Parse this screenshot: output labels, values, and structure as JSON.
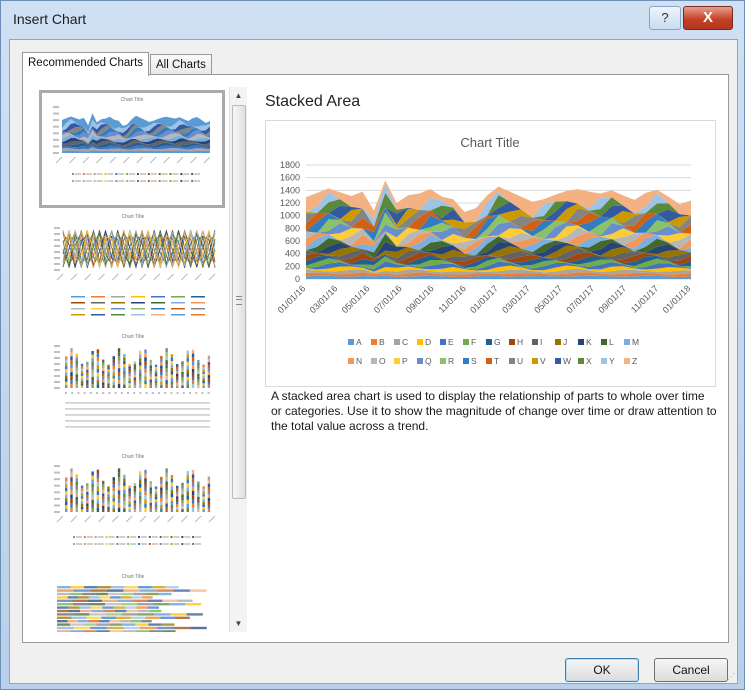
{
  "window": {
    "title": "Insert Chart",
    "help_label": "?",
    "close_label": "X"
  },
  "tabs": [
    {
      "label": "Recommended Charts",
      "active": true
    },
    {
      "label": "All Charts",
      "active": false
    }
  ],
  "thumbnails": [
    {
      "title": "Chart Title",
      "kind": "stacked-area",
      "selected": true
    },
    {
      "title": "Chart Title",
      "kind": "line",
      "selected": false
    },
    {
      "title": "Chart Title",
      "kind": "stacked-column",
      "selected": false
    },
    {
      "title": "Chart Title",
      "kind": "stacked-column-dates",
      "selected": false
    },
    {
      "title": "Chart Title",
      "kind": "stacked-bar",
      "selected": false
    }
  ],
  "scrollbar": {
    "up_icon": "▲",
    "down_icon": "▼"
  },
  "preview": {
    "name": "Stacked Area",
    "description": "A stacked area chart is used to display the relationship of parts to whole over time or categories. Use it to show the magnitude of change over time or draw attention to the total value across a trend."
  },
  "chart_data": {
    "type": "area",
    "stacked": true,
    "title": "Chart Title",
    "xlabel": "",
    "ylabel": "",
    "ylim": [
      0,
      1800
    ],
    "yticks": [
      0,
      200,
      400,
      600,
      800,
      1000,
      1200,
      1400,
      1600,
      1800
    ],
    "grid": true,
    "legend": "bottom",
    "x_tick_labels": [
      "01/01/16",
      "03/01/16",
      "05/01/16",
      "07/01/16",
      "09/01/16",
      "11/01/16",
      "01/01/17",
      "03/01/17",
      "05/01/17",
      "07/01/17",
      "09/01/17",
      "11/01/17",
      "01/01/18"
    ],
    "total": [
      1290,
      1360,
      1430,
      1370,
      1310,
      1380,
      1080,
      1560,
      1200,
      1320,
      1350,
      1420,
      1300,
      1260,
      1060,
      1120,
      1320,
      1460,
      1380,
      1300,
      1220,
      1260,
      1330,
      1390,
      1420,
      1380,
      1350,
      1400,
      1320,
      1250,
      1360,
      1410,
      1300,
      1180,
      1240
    ],
    "series": [
      {
        "name": "A",
        "color": "#5b9bd5"
      },
      {
        "name": "B",
        "color": "#ed7d31"
      },
      {
        "name": "C",
        "color": "#a5a5a5"
      },
      {
        "name": "D",
        "color": "#ffc000"
      },
      {
        "name": "E",
        "color": "#4472c4"
      },
      {
        "name": "F",
        "color": "#70ad47"
      },
      {
        "name": "G",
        "color": "#255e91"
      },
      {
        "name": "H",
        "color": "#9e480e"
      },
      {
        "name": "I",
        "color": "#636363"
      },
      {
        "name": "J",
        "color": "#997300"
      },
      {
        "name": "K",
        "color": "#264478"
      },
      {
        "name": "L",
        "color": "#43682b"
      },
      {
        "name": "M",
        "color": "#7cafdd"
      },
      {
        "name": "N",
        "color": "#f1975a"
      },
      {
        "name": "O",
        "color": "#b7b7b7"
      },
      {
        "name": "P",
        "color": "#ffcd33"
      },
      {
        "name": "Q",
        "color": "#698ed0"
      },
      {
        "name": "R",
        "color": "#8cc168"
      },
      {
        "name": "S",
        "color": "#327dc2"
      },
      {
        "name": "T",
        "color": "#d26012"
      },
      {
        "name": "U",
        "color": "#848484"
      },
      {
        "name": "V",
        "color": "#cc9a00"
      },
      {
        "name": "W",
        "color": "#335aa1"
      },
      {
        "name": "X",
        "color": "#5a8a39"
      },
      {
        "name": "Y",
        "color": "#9dc3e6"
      },
      {
        "name": "Z",
        "color": "#f4b183"
      }
    ]
  },
  "buttons": {
    "ok": "OK",
    "cancel": "Cancel"
  }
}
